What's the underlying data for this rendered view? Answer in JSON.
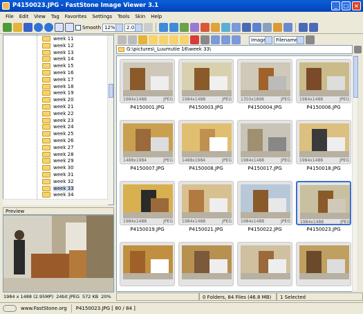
{
  "window": {
    "title": "P4150023.JPG - FastStone Image Viewer 3.1"
  },
  "menu": [
    "File",
    "Edit",
    "View",
    "Tag",
    "Favorites",
    "Settings",
    "Tools",
    "Skin",
    "Help"
  ],
  "toolbar": {
    "smooth_label": "Smooth",
    "zoom_value": "12%",
    "ratio_value": "2.0"
  },
  "tree": {
    "items": [
      "week 11",
      "week 12",
      "week 13",
      "week 14",
      "week 15",
      "week 16",
      "week 17",
      "week 18",
      "week 19",
      "week 20",
      "week 21",
      "week 22",
      "week 23",
      "week 24",
      "week 25",
      "week 26",
      "week 27",
      "week 28",
      "week 29",
      "week 30",
      "week 31",
      "week 32",
      "week 33",
      "week 34"
    ],
    "selected": "week 33"
  },
  "preview": {
    "title": "Preview"
  },
  "image_info": {
    "dims": "1984 x 1488 (2.95MP)",
    "depth": "24bit JPEG",
    "size": "572 KB",
    "zoom": "20%"
  },
  "browser": {
    "filter": "Images",
    "sort": "Filename",
    "path": "G:\\pictures\\_Luumutie 16\\week 33\\"
  },
  "thumbnails": [
    {
      "name": "P4150001.JPG",
      "dims": "1984x1488",
      "type": "JPEG"
    },
    {
      "name": "P4150003.JPG",
      "dims": "1984x1488",
      "type": "JPEG"
    },
    {
      "name": "P4150004.JPG",
      "dims": "1350x1896",
      "type": "JPEG"
    },
    {
      "name": "P4150006.JPG",
      "dims": "1984x1488",
      "type": "JPEG"
    },
    {
      "name": "P4150007.JPG",
      "dims": "1488x1984",
      "type": "JPEG"
    },
    {
      "name": "P4150008.JPG",
      "dims": "1488x1984",
      "type": "JPEG"
    },
    {
      "name": "P4150017.JPG",
      "dims": "1984x1488",
      "type": "JPEG"
    },
    {
      "name": "P4150018.JPG",
      "dims": "1984x1488",
      "type": "JPEG"
    },
    {
      "name": "P4150019.JPG",
      "dims": "1984x1488",
      "type": "JPEG"
    },
    {
      "name": "P4150021.JPG",
      "dims": "1984x1488",
      "type": "JPEG"
    },
    {
      "name": "P4150022.JPG",
      "dims": "1984x1488",
      "type": "JPEG"
    },
    {
      "name": "P4150023.JPG",
      "dims": "1984x1488",
      "type": "JPEG"
    },
    {
      "name": "",
      "dims": "",
      "type": ""
    },
    {
      "name": "",
      "dims": "",
      "type": ""
    },
    {
      "name": "",
      "dims": "",
      "type": ""
    },
    {
      "name": "",
      "dims": "",
      "type": ""
    }
  ],
  "selected_thumb": "P4150023.JPG",
  "status": {
    "folders": "0 Folders, 84 Files (46.8 MB)",
    "selected": "1 Selected"
  },
  "bottom": {
    "site": "www.FastStone.org",
    "current": "P4150023.JPG [ 80 / 84 ]"
  },
  "colors": {
    "title_bg": "#0a5fd8",
    "selection": "#3a6fc9",
    "folder": "#f6d36b"
  }
}
